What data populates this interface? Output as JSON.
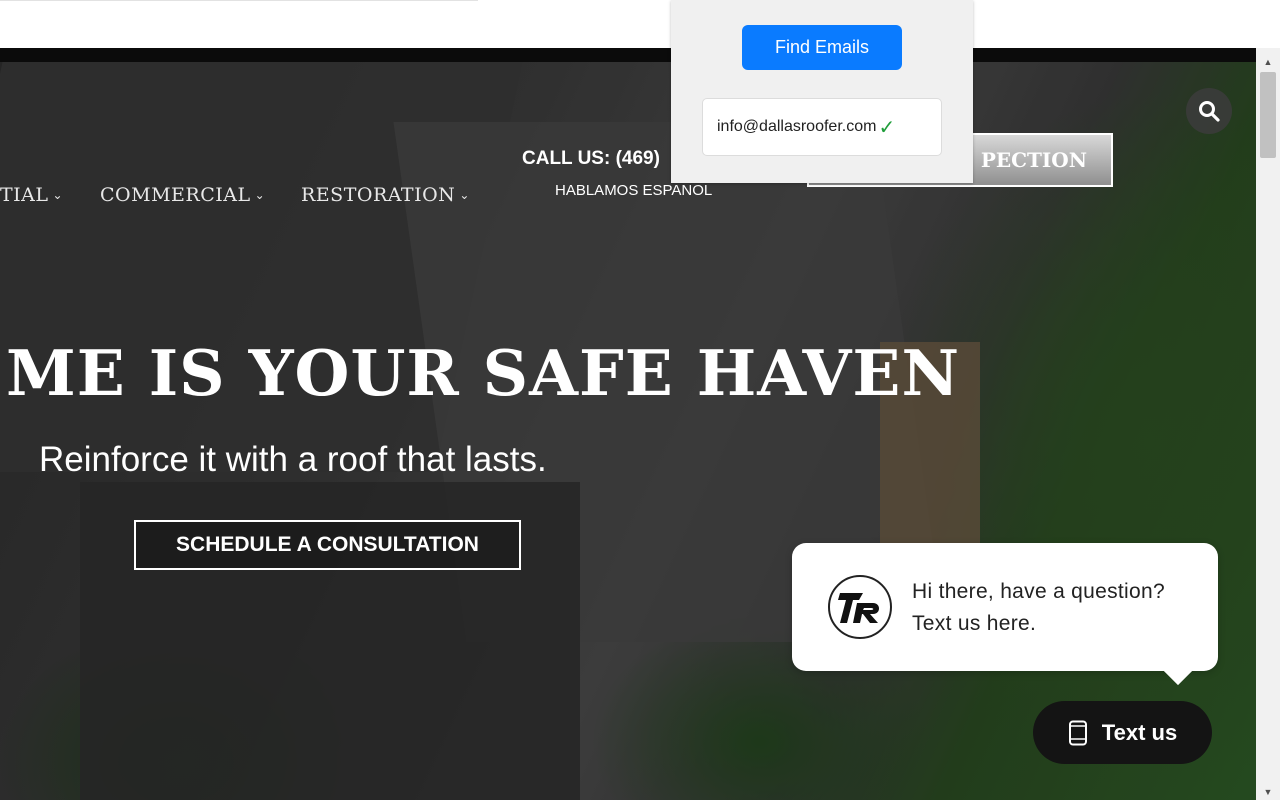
{
  "nav": {
    "items": [
      {
        "label": "TIAL"
      },
      {
        "label": "COMMERCIAL"
      },
      {
        "label": "RESTORATION"
      }
    ]
  },
  "header": {
    "call_us": "CALL US: (469)",
    "hablamos": "HABLAMOS ESPANOL",
    "inspection_label": "PECTION"
  },
  "hero": {
    "headline": "ME IS YOUR SAFE HAVEN",
    "subhead": "Reinforce it with a roof that lasts.",
    "cta_label": "SCHEDULE A CONSULTATION"
  },
  "popup": {
    "find_label": "Find Emails",
    "email": "info@dallasroofer.com",
    "check": "✓"
  },
  "chat": {
    "message": "Hi there, have a question? Text us here.",
    "button_label": "Text us"
  },
  "icons": {
    "search": "search-icon",
    "chevron": "chevron-down-icon",
    "phone": "phone-icon",
    "logo": "company-logo"
  },
  "colors": {
    "find_button": "#0a7bff",
    "check": "#1f9d3a",
    "text_us_button": "#141414"
  }
}
